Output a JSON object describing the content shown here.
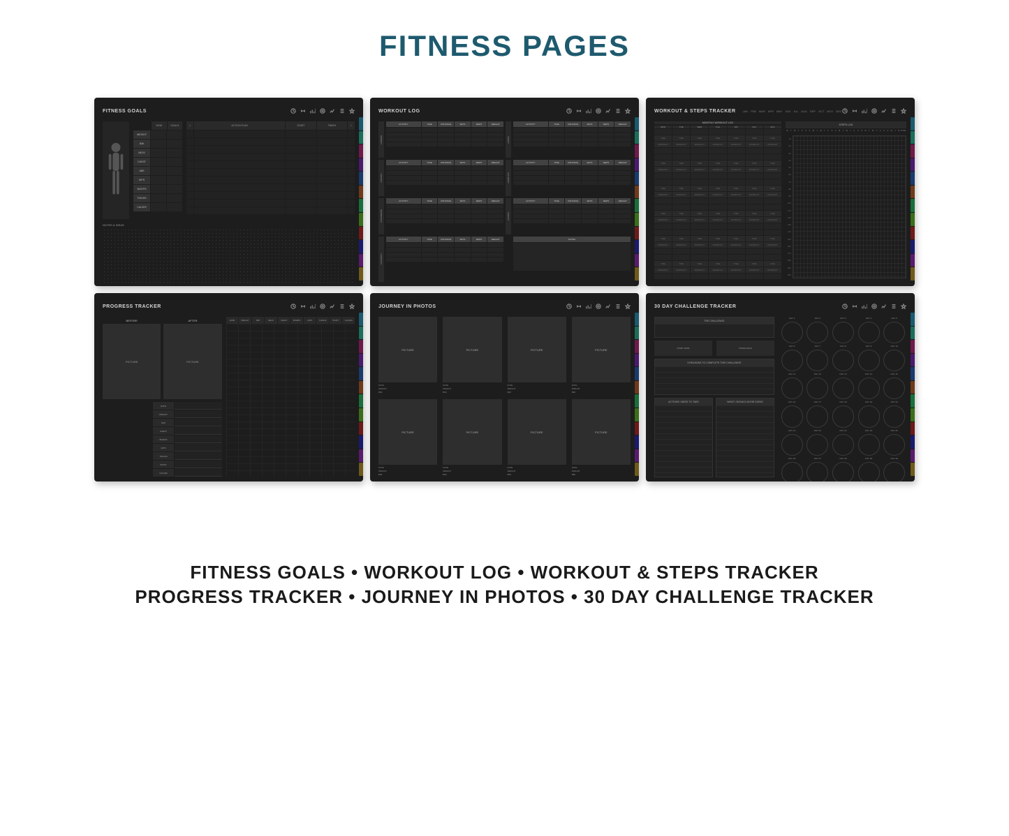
{
  "title": "FITNESS PAGES",
  "footer": {
    "line1": "FITNESS GOALS • WORKOUT LOG • WORKOUT & STEPS TRACKER",
    "line2": "PROGRESS TRACKER • JOURNEY IN PHOTOS • 30 DAY CHALLENGE TRACKER"
  },
  "panels": {
    "fitness_goals": {
      "title": "FITNESS GOALS",
      "head_now": "NOW",
      "head_goals": "GOALS",
      "metrics": [
        "WEIGHT",
        "BMI",
        "NECK",
        "CHEST",
        "ABS",
        "HIPS",
        "BICEPS",
        "THIGHS",
        "CALVES"
      ],
      "plan_head_check": "✓",
      "plan_head_action": "ACTION PLAN",
      "plan_head_start": "START",
      "plan_head_finish": "FINISH",
      "plan_head_done": "✓",
      "notes_title": "NOTES & IDEAS"
    },
    "workout_log": {
      "title": "WORKOUT LOG",
      "cols": [
        "ACTIVITY",
        "TIME",
        "DISTANCE",
        "SETS",
        "REPS",
        "WEIGHT"
      ],
      "days": [
        "MONDAY",
        "TUESDAY",
        "WEDNESDAY",
        "THURSDAY",
        "FRIDAY",
        "SATURDAY",
        "SUNDAY"
      ],
      "notes": "NOTES"
    },
    "workout_steps": {
      "title": "WORKOUT & STEPS TRACKER",
      "months": [
        "JAN",
        "FEB",
        "MAR",
        "APR",
        "MAY",
        "JUN",
        "JUL",
        "AUG",
        "SEP",
        "OCT",
        "NOV",
        "DEC"
      ],
      "left_title": "MONTHLY WORKOUT LOG",
      "days": [
        "MON",
        "TUE",
        "WED",
        "THU",
        "FRI",
        "SAT",
        "SUN"
      ],
      "cell_time": "TIME",
      "cell_workout": "WORKOUT",
      "right_title": "STEPS LOG",
      "step_days": [
        "M",
        "T",
        "W",
        "T",
        "F",
        "S",
        "S",
        "M",
        "T",
        "W",
        "T",
        "F",
        "S",
        "S",
        "M",
        "T",
        "W",
        "T",
        "F",
        "S",
        "S",
        "M",
        "T",
        "W",
        "T",
        "F",
        "S",
        "S",
        "M",
        "T",
        "W",
        "TOTAL"
      ],
      "step_rows": [
        "1K",
        "2K",
        "3K",
        "4K",
        "5K",
        "6K",
        "7K",
        "8K",
        "9K",
        "10K",
        "11K",
        "12K",
        "13K",
        "14K",
        "15K",
        "16K",
        "17K",
        "18K",
        "19K",
        "20K"
      ]
    },
    "progress_tracker": {
      "title": "PROGRESS TRACKER",
      "before": "BEFORE",
      "after": "AFTER",
      "picture": "PICTURE",
      "stats": [
        "DATE",
        "WEIGHT",
        "BMI",
        "CHEST",
        "BICEPS",
        "HIPS",
        "THIGHS",
        "WAIST",
        "CALVES"
      ],
      "table_cols": [
        "DATE",
        "WEIGHT",
        "BMI",
        "NECK",
        "CHEST",
        "BICEPS",
        "HIPS",
        "THIGHS",
        "WAIST",
        "CALVES"
      ]
    },
    "journey_photos": {
      "title": "JOURNEY IN PHOTOS",
      "picture": "PICTURE",
      "meta": [
        "DATE",
        "WEIGHT",
        "BMI"
      ]
    },
    "challenge": {
      "title": "30 DAY CHALLENGE TRACKER",
      "challenge_label": "THE CHALLENGE",
      "start_date": "START DATE",
      "finish_date": "FINISH DATE",
      "reasons": "5 REASONS TO COMPLETE THIS CHALLENGE",
      "actions": "ACTIONS I NEED TO TAKE",
      "avoid": "WHAT I SHOULD AVOID DOING",
      "day_prefix": "DAY"
    }
  },
  "tab_colors": [
    "#1a5a6e",
    "#1a6e5a",
    "#6e1a4a",
    "#4a1a6e",
    "#1a3a6e",
    "#6e3a1a",
    "#1a6e3a",
    "#3a6e1a",
    "#6e1a1a",
    "#1a1a6e",
    "#5a1a6e",
    "#6e5a1a"
  ]
}
